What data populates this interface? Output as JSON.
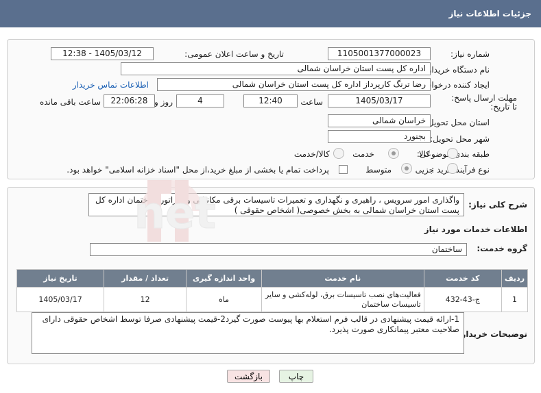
{
  "header": {
    "title": "جزئیات اطلاعات نیاز"
  },
  "form": {
    "need_number_label": "شماره نیاز:",
    "need_number": "1105001377000023",
    "announce_label": "تاریخ و ساعت اعلان عمومی:",
    "announce_value": "1405/03/12 - 12:38",
    "buyer_org_label": "نام دستگاه خریدار:",
    "buyer_org": "اداره کل پست استان خراسان شمالی",
    "creator_label": "ایجاد کننده درخواست:",
    "creator": "رضا ترنگ کارپرداز اداره کل پست استان خراسان شمالی",
    "contact_link": "اطلاعات تماس خریدار",
    "deadline_label": "مهلت ارسال پاسخ: تا تاریخ:",
    "deadline_date": "1405/03/17",
    "time_label": "ساعت",
    "deadline_time": "12:40",
    "days_value": "4",
    "days_label": "روز و",
    "remaining_time": "22:06:28",
    "remaining_label": "ساعت باقی مانده",
    "province_label": "استان محل تحویل:",
    "province": "خراسان شمالی",
    "city_label": "شهر محل تحویل:",
    "city": "بجنورد",
    "category_label": "طبقه بندی موضوعی:",
    "category_options": [
      "کالا",
      "خدمت",
      "کالا/خدمت"
    ],
    "process_label": "نوع فرآیند خرید :",
    "process_options": [
      "جزیی",
      "متوسط"
    ],
    "payment_note": "پرداخت تمام یا بخشی از مبلغ خرید،از محل \"اسناد خزانه اسلامی\" خواهد بود."
  },
  "summary": {
    "label": "شرح کلی نیاز:",
    "text": "واگذاری امور سرویس ، راهبری و نگهداری و تعمیرات تاسیسات برقی مکانیکی و ژنراتور ساختمان اداره کل پست استان خراسان شمالی به بخش خصوصی( اشخاص حقوقی )"
  },
  "services": {
    "section_title": "اطلاعات خدمات مورد نیاز",
    "group_label": "گروه خدمت:",
    "group_value": "ساختمان",
    "columns": [
      "ردیف",
      "کد خدمت",
      "نام خدمت",
      "واحد اندازه گیری",
      "تعداد / مقدار",
      "تاریخ نیاز"
    ],
    "rows": [
      [
        "1",
        "ج-43-432",
        "فعالیت‌های نصب تاسیسات برق، لوله‌کشی و سایر تاسیسات ساختمان",
        "ماه",
        "12",
        "1405/03/17"
      ]
    ]
  },
  "notes": {
    "label": "توضیحات خریدار:",
    "text": "1-ارائه قیمت پیشنهادی در قالب فرم استعلام بها پیوست صورت گیرد2-قیمت پیشنهادی صرفا توسط اشخاص حقوقی دارای صلاحیت معتبر پیمانکاری صورت پذیرد."
  },
  "buttons": {
    "print": "چاپ",
    "back": "بازگشت"
  },
  "colors": {
    "header_bg": "#5a6f8e",
    "table_header_bg": "#717f8f",
    "link": "#1a5fb4"
  }
}
